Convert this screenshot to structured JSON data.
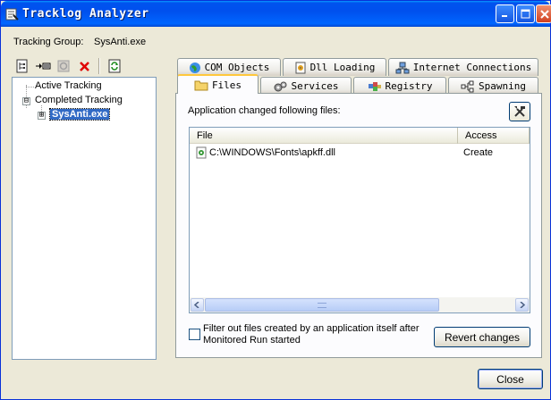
{
  "window": {
    "title": "Tracklog Analyzer",
    "controls": {
      "minimize": "minimize-icon",
      "maximize": "maximize-icon",
      "close": "close-icon"
    }
  },
  "tracking_group": {
    "label": "Tracking Group:",
    "value": "SysAnti.exe"
  },
  "toolbar": {
    "icons": [
      "tree-view-icon",
      "arrow-list-icon",
      "record-icon",
      "delete-icon",
      "refresh-icon"
    ]
  },
  "tree": {
    "items": [
      {
        "label": "Active Tracking"
      },
      {
        "label": "Completed Tracking",
        "expander": "⊟"
      },
      {
        "label": "SysAnti.exe",
        "expander": "⊞"
      }
    ]
  },
  "tabs": {
    "row1": [
      {
        "label": "COM Objects",
        "icon": "globe-icon"
      },
      {
        "label": "Dll Loading",
        "icon": "dll-icon"
      },
      {
        "label": "Internet Connections",
        "icon": "network-icon"
      }
    ],
    "row2": [
      {
        "label": "Files",
        "icon": "folder-icon",
        "active": true
      },
      {
        "label": "Services",
        "icon": "gears-icon"
      },
      {
        "label": "Registry",
        "icon": "registry-icon"
      },
      {
        "label": "Spawning",
        "icon": "spawning-icon"
      }
    ]
  },
  "files_panel": {
    "description": "Application changed following files:",
    "columns": [
      "File",
      "Access"
    ],
    "rows": [
      {
        "file": "C:\\WINDOWS\\Fonts\\apkff.dll",
        "access": "Create"
      }
    ],
    "filter_label": "Filter out files created by an application itself after Monitored Run started",
    "filter_checked": false,
    "revert_label": "Revert changes"
  },
  "footer": {
    "close_label": "Close"
  },
  "colors": {
    "titlebar": "#0053ee",
    "selection": "#316ac5",
    "tab_highlight": "#ffc83c"
  }
}
